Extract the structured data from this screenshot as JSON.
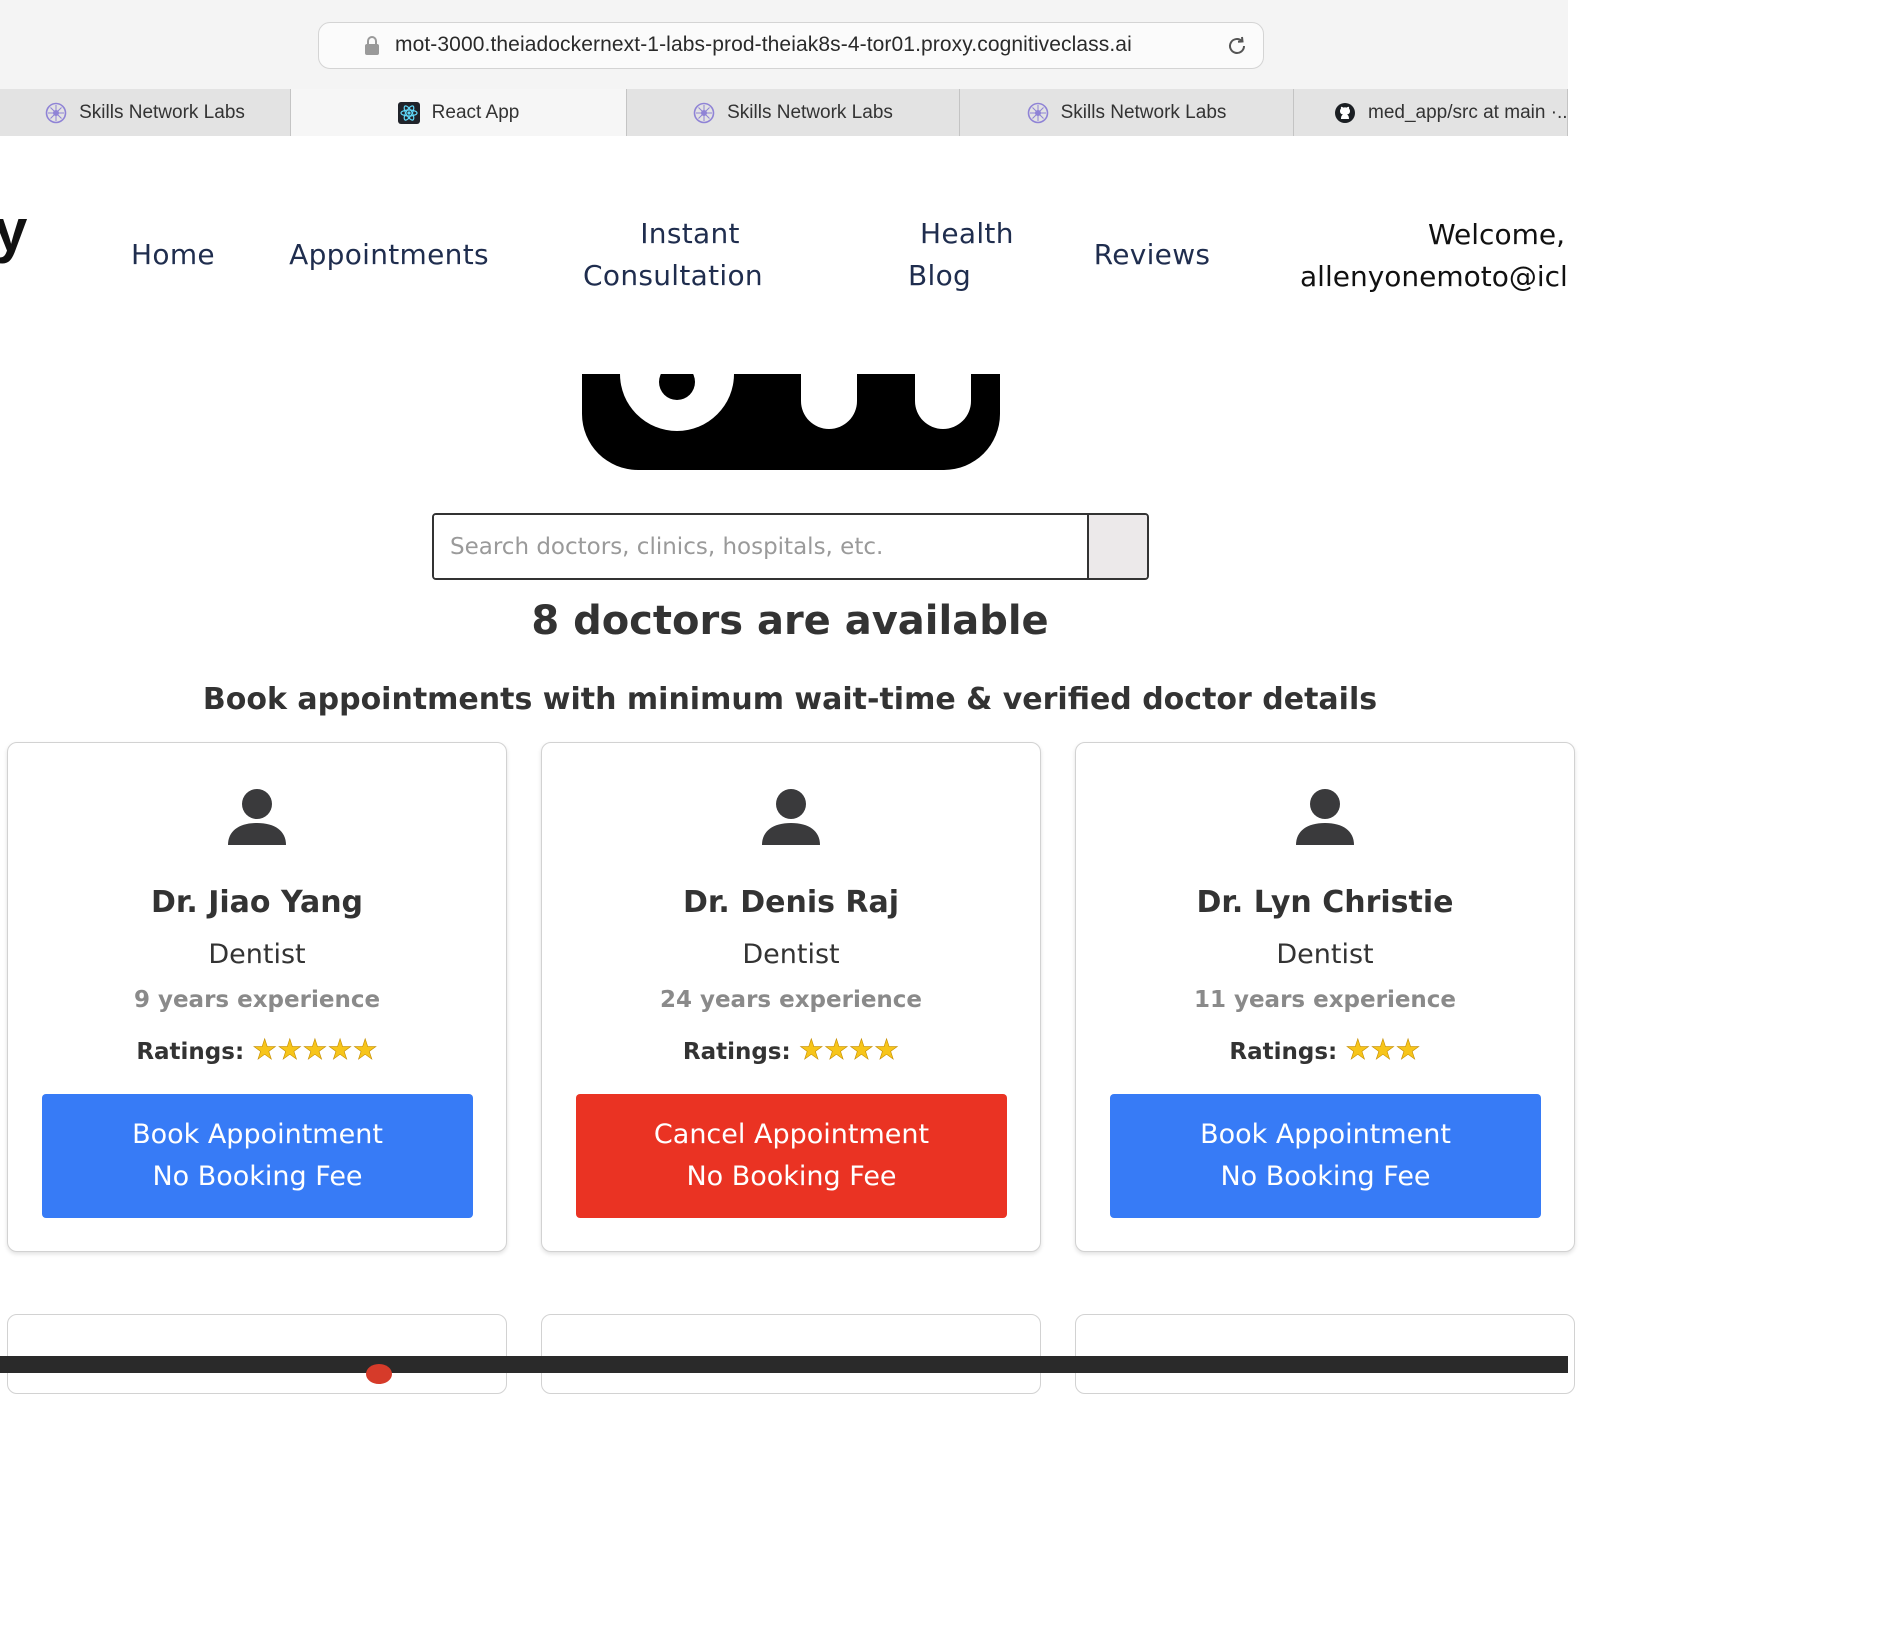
{
  "browser": {
    "url": "mot-3000.theiadockernext-1-labs-prod-theiak8s-4-tor01.proxy.cognitiveclass.ai",
    "tabs": [
      {
        "label": "Skills Network Labs",
        "icon": "skills-network-icon",
        "active": false
      },
      {
        "label": "React App",
        "icon": "react-icon",
        "active": true
      },
      {
        "label": "Skills Network Labs",
        "icon": "skills-network-icon",
        "active": false
      },
      {
        "label": "Skills Network Labs",
        "icon": "skills-network-icon",
        "active": false
      },
      {
        "label": "med_app/src at main ·...",
        "icon": "github-icon",
        "active": false
      }
    ]
  },
  "nav": {
    "logo_fragment": "y",
    "home": "Home",
    "appointments": "Appointments",
    "instant_1": "Instant",
    "instant_2": "Consultation",
    "health_1": "Health",
    "health_2": "Blog",
    "reviews": "Reviews",
    "welcome_1": "Welcome,",
    "welcome_2": "allenyonemoto@icl"
  },
  "search": {
    "placeholder": "Search doctors, clinics, hospitals, etc."
  },
  "headline": "8 doctors are available",
  "subtitle": "Book appointments with minimum wait-time & verified doctor details",
  "doctors": [
    {
      "name": "Dr. Jiao Yang",
      "speciality": "Dentist",
      "experience": "9 years experience",
      "ratings_label": "Ratings:",
      "stars": "★★★★★",
      "rating": 5,
      "button_line1": "Book Appointment",
      "button_line2": "No Booking Fee",
      "button_type": "book"
    },
    {
      "name": "Dr. Denis Raj",
      "speciality": "Dentist",
      "experience": "24 years experience",
      "ratings_label": "Ratings:",
      "stars": "★★★★",
      "rating": 4,
      "button_line1": "Cancel Appointment",
      "button_line2": "No Booking Fee",
      "button_type": "cancel"
    },
    {
      "name": "Dr. Lyn Christie",
      "speciality": "Dentist",
      "experience": "11 years experience",
      "ratings_label": "Ratings:",
      "stars": "★★★",
      "rating": 3,
      "button_line1": "Book Appointment",
      "button_line2": "No Booking Fee",
      "button_type": "book"
    }
  ],
  "colors": {
    "book": "#377bf6",
    "cancel": "#ea3323",
    "nav": "#1f2d4e",
    "star": "#f7c51a"
  }
}
